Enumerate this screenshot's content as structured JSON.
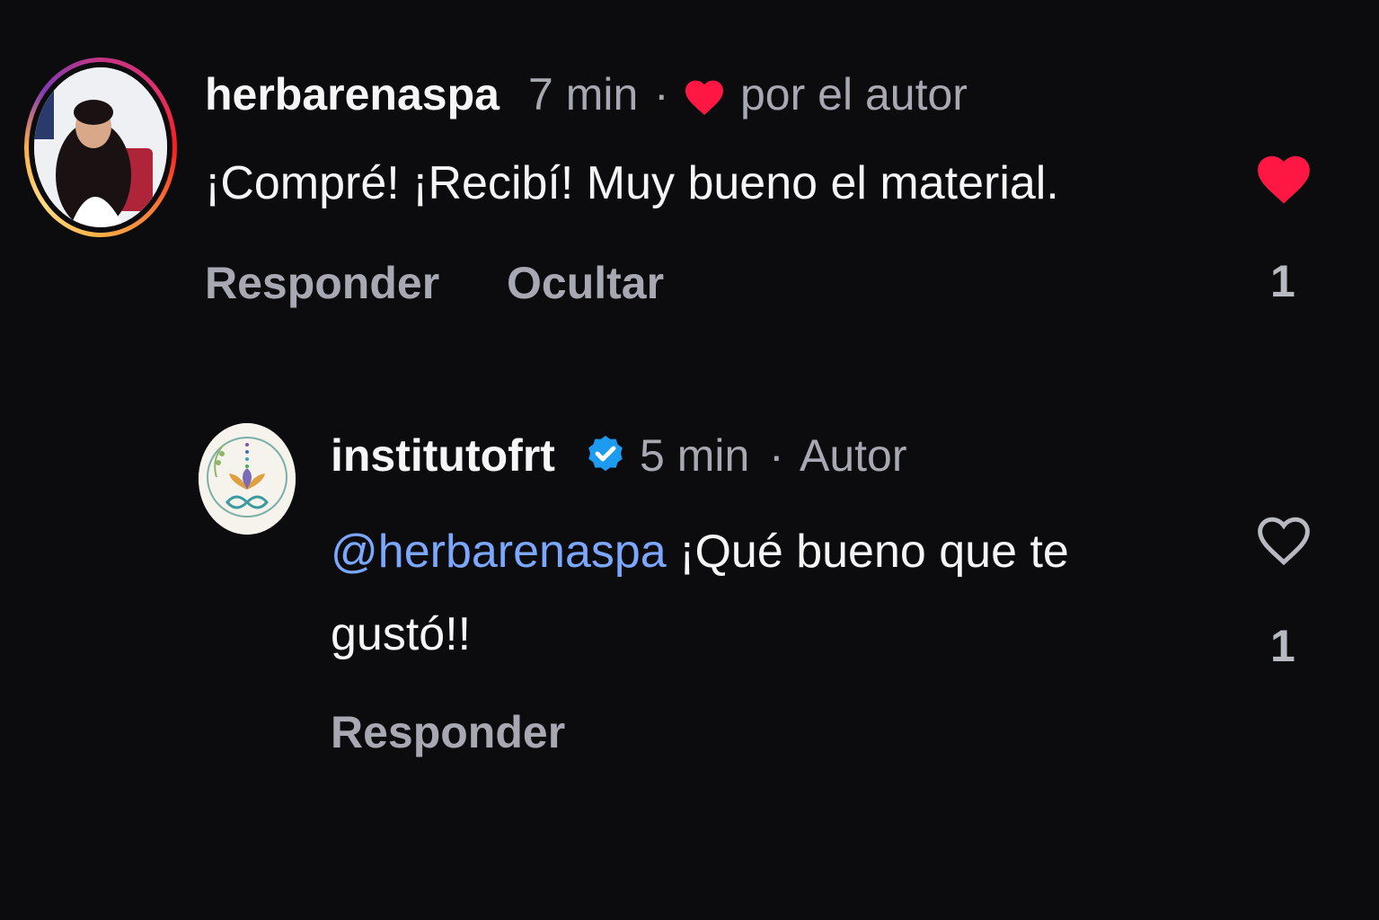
{
  "comment": {
    "username": "herbarenaspa",
    "time": "7 min",
    "separator": "·",
    "liked_by_author_label": "por el autor",
    "text": "¡Compré! ¡Recibí! Muy bueno el material.",
    "reply_label": "Responder",
    "hide_label": "Ocultar",
    "like_count": "1",
    "liked": true
  },
  "reply": {
    "username": "institutofrt",
    "verified": true,
    "time": "5 min",
    "separator": "·",
    "author_label": "Autor",
    "mention": "@herbarenaspa",
    "text_line1": "¡Qué bueno que te",
    "text_line2": "gustó!!",
    "reply_label": "Responder",
    "like_count": "1",
    "liked": false
  },
  "colors": {
    "background": "#0c0c0f",
    "heart_red": "#ff1744",
    "mention_blue": "#7ba7ff",
    "verified_blue": "#1d9bf0",
    "muted_text": "#a8a8b3"
  }
}
